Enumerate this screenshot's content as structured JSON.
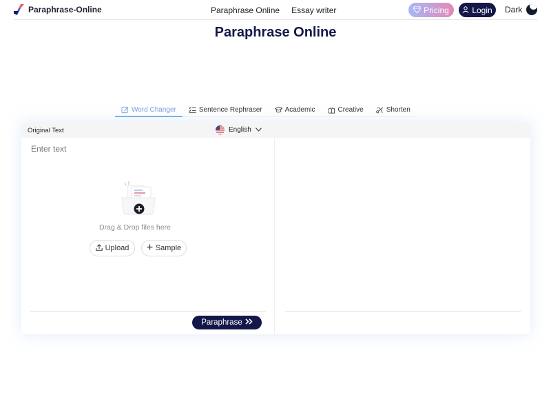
{
  "header": {
    "brand_name": "Paraphrase-Online",
    "nav": [
      {
        "label": "Paraphrase Online"
      },
      {
        "label": "Essay writer"
      }
    ],
    "pricing_label": "Pricing",
    "login_label": "Login",
    "theme_label": "Dark"
  },
  "page": {
    "title": "Paraphrase Online"
  },
  "tabs": [
    {
      "label": "Word Changer",
      "active": true,
      "icon": "edit-icon"
    },
    {
      "label": "Sentence Rephraser",
      "active": false,
      "icon": "list-check-icon"
    },
    {
      "label": "Academic",
      "active": false,
      "icon": "graduation-cap-icon"
    },
    {
      "label": "Creative",
      "active": false,
      "icon": "gift-icon"
    },
    {
      "label": "Shorten",
      "active": false,
      "icon": "scissors-icon"
    }
  ],
  "editor": {
    "original_label": "Original Text",
    "language": "English",
    "placeholder": "Enter text",
    "drop_text": "Drag & Drop files here",
    "upload_label": "Upload",
    "sample_label": "Sample",
    "paraphrase_label": "Paraphrase"
  },
  "colors": {
    "brand_dark": "#14174a",
    "tab_active": "#7a9ee0"
  }
}
